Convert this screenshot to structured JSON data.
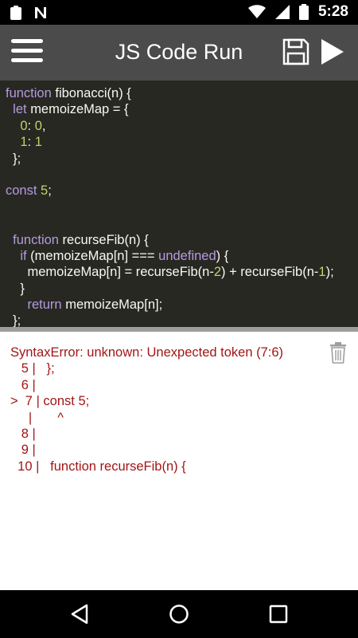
{
  "status_bar": {
    "time": "5:28",
    "icons": [
      "clipboard-icon",
      "n-notification-icon",
      "wifi-icon",
      "signal-icon",
      "battery-icon"
    ]
  },
  "app_bar": {
    "title": "JS Code Run",
    "icons": [
      "menu-icon",
      "save-icon",
      "play-icon"
    ]
  },
  "editor": {
    "lines": [
      [
        {
          "t": "function ",
          "c": "kw"
        },
        {
          "t": "fibonacci(",
          "c": "fn"
        },
        {
          "t": "n",
          "c": "pl"
        },
        {
          "t": ") {",
          "c": "pl"
        }
      ],
      [
        {
          "t": "  let ",
          "c": "kw"
        },
        {
          "t": "memoizeMap = {",
          "c": "pl"
        }
      ],
      [
        {
          "t": "    ",
          "c": "pl"
        },
        {
          "t": "0",
          "c": "num"
        },
        {
          "t": ": ",
          "c": "pl"
        },
        {
          "t": "0",
          "c": "num"
        },
        {
          "t": ",",
          "c": "pl"
        }
      ],
      [
        {
          "t": "    ",
          "c": "pl"
        },
        {
          "t": "1",
          "c": "num"
        },
        {
          "t": ": ",
          "c": "pl"
        },
        {
          "t": "1",
          "c": "num"
        }
      ],
      [
        {
          "t": "  };",
          "c": "pl"
        }
      ],
      [
        {
          "t": "",
          "c": "pl"
        }
      ],
      [
        {
          "t": "const ",
          "c": "kw"
        },
        {
          "t": "5",
          "c": "num"
        },
        {
          "t": ";",
          "c": "pl"
        }
      ],
      [
        {
          "t": "",
          "c": "pl"
        }
      ],
      [
        {
          "t": "",
          "c": "pl"
        }
      ],
      [
        {
          "t": "  function ",
          "c": "kw"
        },
        {
          "t": "recurseFib(",
          "c": "fn"
        },
        {
          "t": "n",
          "c": "pl"
        },
        {
          "t": ") {",
          "c": "pl"
        }
      ],
      [
        {
          "t": "    if ",
          "c": "kw"
        },
        {
          "t": "(memoizeMap[",
          "c": "pl"
        },
        {
          "t": "n",
          "c": "pl"
        },
        {
          "t": "] === ",
          "c": "pl"
        },
        {
          "t": "undefined",
          "c": "kw"
        },
        {
          "t": ") {",
          "c": "pl"
        }
      ],
      [
        {
          "t": "      memoizeMap[",
          "c": "pl"
        },
        {
          "t": "n",
          "c": "pl"
        },
        {
          "t": "] = recurseFib(",
          "c": "pl"
        },
        {
          "t": "n-",
          "c": "pl"
        },
        {
          "t": "2",
          "c": "num"
        },
        {
          "t": ") + recurseFib(",
          "c": "pl"
        },
        {
          "t": "n-",
          "c": "pl"
        },
        {
          "t": "1",
          "c": "num"
        },
        {
          "t": ");",
          "c": "pl"
        }
      ],
      [
        {
          "t": "    }",
          "c": "pl"
        }
      ],
      [
        {
          "t": "      return ",
          "c": "kw"
        },
        {
          "t": "memoizeMap[",
          "c": "pl"
        },
        {
          "t": "n",
          "c": "pl"
        },
        {
          "t": "];",
          "c": "pl"
        }
      ],
      [
        {
          "t": "  };",
          "c": "pl"
        }
      ]
    ]
  },
  "output": {
    "lines": [
      "SyntaxError: unknown: Unexpected token (7:6)",
      "   5 |   };",
      "   6 |",
      ">  7 | const 5;",
      "     |       ^",
      "   8 |",
      "   9 |",
      "  10 |   function recurseFib(n) {"
    ],
    "icon": "trash-icon"
  },
  "nav_bar": {
    "icons": [
      "back-icon",
      "home-icon",
      "recents-icon"
    ]
  }
}
